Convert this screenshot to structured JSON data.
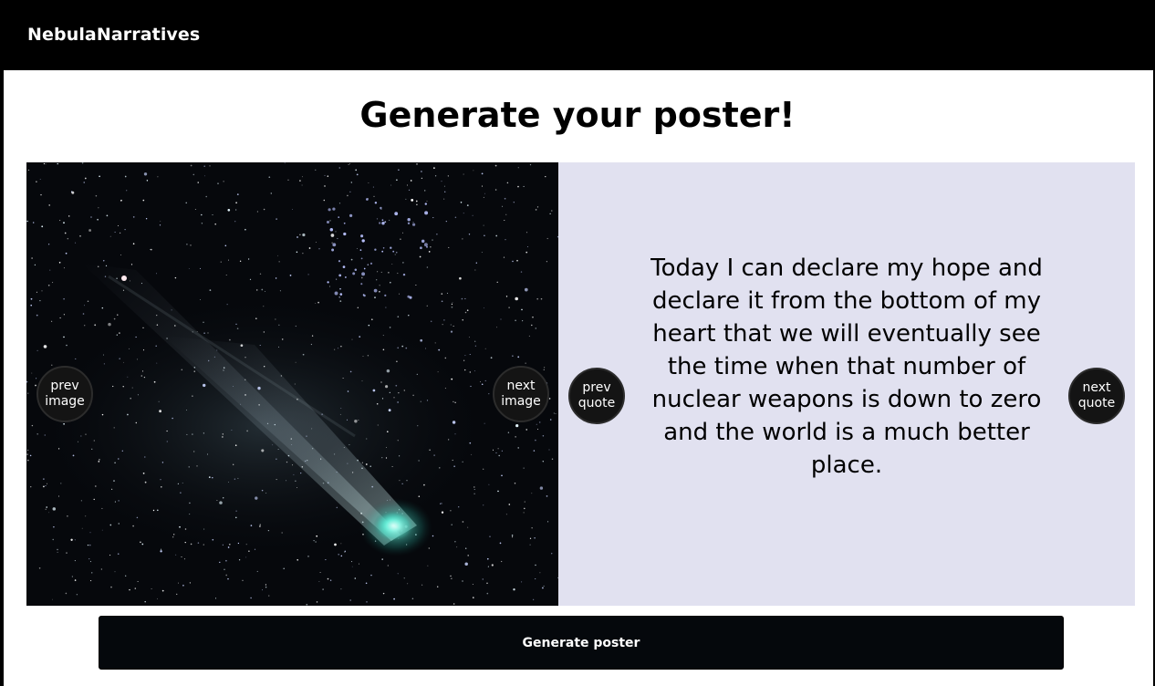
{
  "navbar": {
    "brand": "NebulaNarratives"
  },
  "main": {
    "title": "Generate your poster!"
  },
  "image_panel": {
    "description_icon": "comet-night-sky-image",
    "prev_label_line1": "prev",
    "prev_label_line2": "image",
    "next_label_line1": "next",
    "next_label_line2": "image"
  },
  "quote_panel": {
    "quote": "Today I can declare my hope and declare it from the bottom of my heart that we will eventually see the time when that number of nuclear weapons is down to zero and the world is a much better place.",
    "prev_label_line1": "prev",
    "prev_label_line2": "quote",
    "next_label_line1": "next",
    "next_label_line2": "quote",
    "background_color": "#e1e1f0"
  },
  "actions": {
    "generate_label": "Generate poster"
  }
}
